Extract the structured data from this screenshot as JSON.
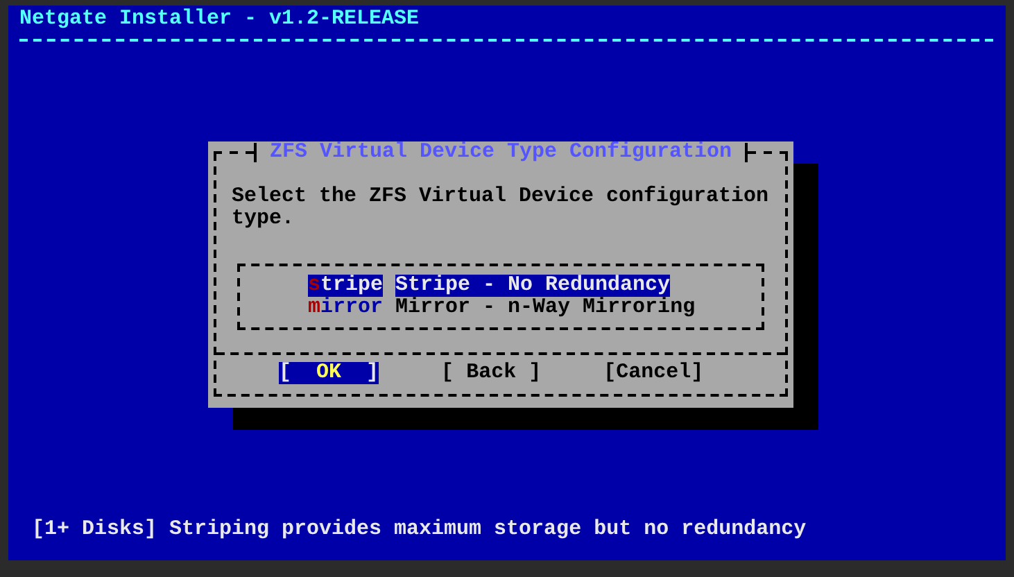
{
  "header": {
    "title": "Netgate Installer - v1.2-RELEASE"
  },
  "dialog": {
    "title": "ZFS Virtual Device Type Configuration",
    "prompt": "Select the ZFS Virtual Device configuration type.",
    "options": [
      {
        "tag": "stripe",
        "description": "Stripe - No Redundancy",
        "selected": true
      },
      {
        "tag": "mirror",
        "description": "Mirror - n-Way Mirroring",
        "selected": false
      }
    ],
    "buttons": [
      {
        "label": "[  OK  ]",
        "selected": true
      },
      {
        "label": "[ Back ]",
        "selected": false
      },
      {
        "label": "[Cancel]",
        "selected": false
      }
    ]
  },
  "status_bar": "[1+ Disks] Striping provides maximum storage but no redundancy"
}
